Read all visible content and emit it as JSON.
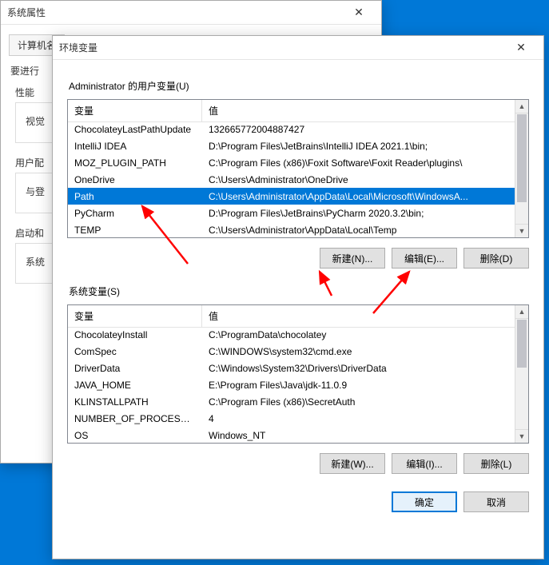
{
  "sys": {
    "title": "系统属性",
    "tab0": "计算机名",
    "body_label": "要进行",
    "g1": "性能",
    "g1_line": "视觉",
    "g2": "用户配",
    "g2_line": "与登",
    "g3": "启动和",
    "g3_line": "系统"
  },
  "env": {
    "title": "环境变量",
    "user_label": "Administrator 的用户变量(U)",
    "sys_label": "系统变量(S)",
    "col_var": "变量",
    "col_val": "值",
    "user_vars": [
      {
        "var": "ChocolateyLastPathUpdate",
        "val": "132665772004887427"
      },
      {
        "var": "IntelliJ IDEA",
        "val": "D:\\Program Files\\JetBrains\\IntelliJ IDEA 2021.1\\bin;"
      },
      {
        "var": "MOZ_PLUGIN_PATH",
        "val": "C:\\Program Files (x86)\\Foxit Software\\Foxit Reader\\plugins\\"
      },
      {
        "var": "OneDrive",
        "val": "C:\\Users\\Administrator\\OneDrive"
      },
      {
        "var": "Path",
        "val": "C:\\Users\\Administrator\\AppData\\Local\\Microsoft\\WindowsA...",
        "selected": true
      },
      {
        "var": "PyCharm",
        "val": "D:\\Program Files\\JetBrains\\PyCharm 2020.3.2\\bin;"
      },
      {
        "var": "TEMP",
        "val": "C:\\Users\\Administrator\\AppData\\Local\\Temp"
      }
    ],
    "sys_vars": [
      {
        "var": "ChocolateyInstall",
        "val": "C:\\ProgramData\\chocolatey"
      },
      {
        "var": "ComSpec",
        "val": "C:\\WINDOWS\\system32\\cmd.exe"
      },
      {
        "var": "DriverData",
        "val": "C:\\Windows\\System32\\Drivers\\DriverData"
      },
      {
        "var": "JAVA_HOME",
        "val": "E:\\Program Files\\Java\\jdk-11.0.9"
      },
      {
        "var": "KLINSTALLPATH",
        "val": "C:\\Program Files (x86)\\SecretAuth"
      },
      {
        "var": "NUMBER_OF_PROCESSORS",
        "val": "4"
      },
      {
        "var": "OS",
        "val": "Windows_NT"
      }
    ],
    "btn_new_u": "新建(N)...",
    "btn_edit_u": "编辑(E)...",
    "btn_del_u": "删除(D)",
    "btn_new_s": "新建(W)...",
    "btn_edit_s": "编辑(I)...",
    "btn_del_s": "删除(L)",
    "btn_ok": "确定",
    "btn_cancel": "取消"
  }
}
